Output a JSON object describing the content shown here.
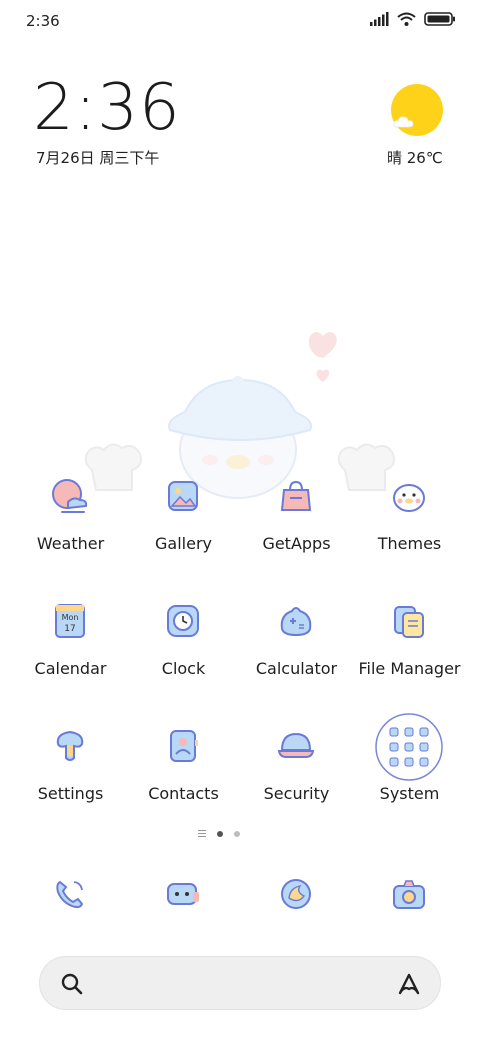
{
  "status_bar": {
    "time": "2:36"
  },
  "clock_widget": {
    "time": "2:36",
    "date": "7月26日 周三下午"
  },
  "weather_widget": {
    "text": "晴 26℃",
    "icon": "sun-cloud-icon"
  },
  "apps": [
    {
      "label": "Weather",
      "icon": "weather-icon"
    },
    {
      "label": "Gallery",
      "icon": "gallery-icon"
    },
    {
      "label": "GetApps",
      "icon": "getapps-icon"
    },
    {
      "label": "Themes",
      "icon": "themes-icon"
    },
    {
      "label": "Calendar",
      "icon": "calendar-icon",
      "icon_text": [
        "Mon",
        "17"
      ]
    },
    {
      "label": "Clock",
      "icon": "clock-icon"
    },
    {
      "label": "Calculator",
      "icon": "calculator-icon"
    },
    {
      "label": "File Manager",
      "icon": "file-manager-icon"
    },
    {
      "label": "Settings",
      "icon": "settings-icon"
    },
    {
      "label": "Contacts",
      "icon": "contacts-icon"
    },
    {
      "label": "Security",
      "icon": "security-icon"
    },
    {
      "label": "System",
      "icon": "system-folder-icon"
    }
  ],
  "page_indicator": {
    "pages": 2,
    "active_index": 0
  },
  "dock": [
    {
      "icon": "phone-icon"
    },
    {
      "icon": "messages-icon"
    },
    {
      "icon": "browser-icon"
    },
    {
      "icon": "camera-icon"
    }
  ],
  "search_bar": {
    "icons": [
      "search-icon",
      "assistant-icon"
    ]
  },
  "colors": {
    "icon_fill": "#b8d8f5",
    "icon_outline": "#6a7ad8",
    "accent_pink": "#f7b8b8",
    "sun": "#ffd21a"
  }
}
